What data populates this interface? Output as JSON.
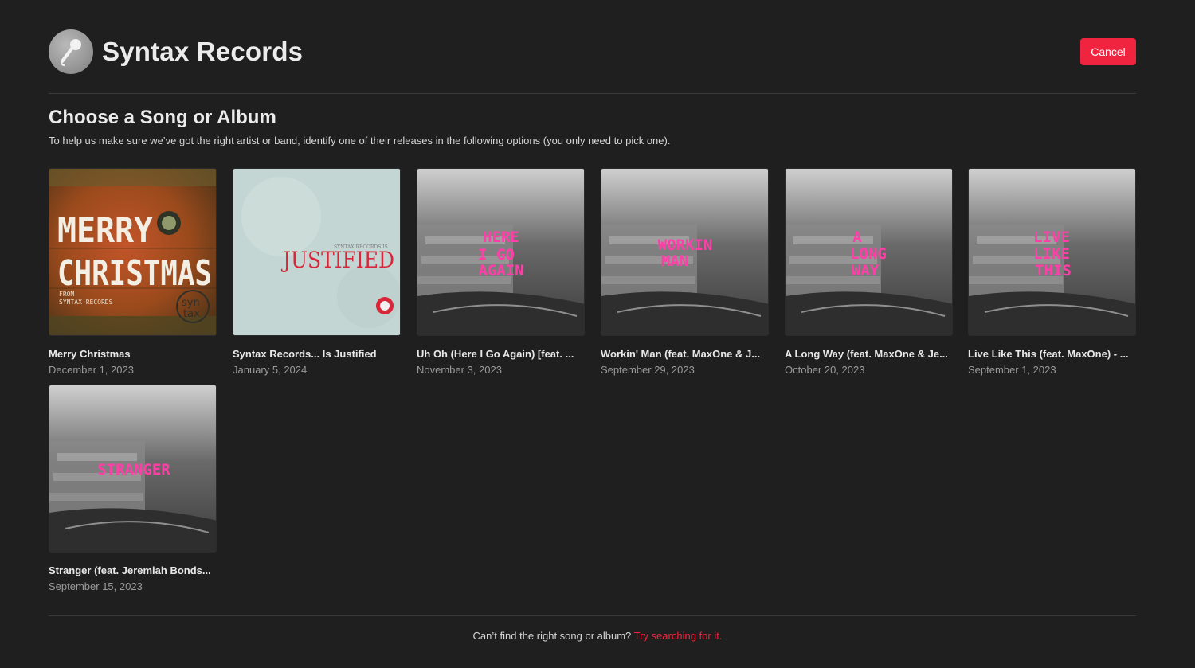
{
  "header": {
    "artist_name": "Syntax Records",
    "cancel_label": "Cancel",
    "avatar_icon": "microphone-icon"
  },
  "section": {
    "title": "Choose a Song or Album",
    "subtitle": "To help us make sure we’ve got the right artist or band, identify one of their releases in the following options (you only need to pick one)."
  },
  "releases": [
    {
      "title": "Merry Christmas",
      "date": "December 1, 2023",
      "art_text": [
        "MERRY",
        "CHRISTMAS"
      ],
      "art_small": [
        "FROM",
        "SYNTAX RECORDS"
      ],
      "art_logo": [
        "syn",
        "tax"
      ]
    },
    {
      "title": "Syntax Records... Is Justified",
      "date": "January 5, 2024",
      "art_text": [
        "JUSTIFIED"
      ],
      "art_small": [
        "SYNTAX RECORDS IS"
      ]
    },
    {
      "title": "Uh Oh (Here I Go Again) [feat. ...",
      "date": "November 3, 2023",
      "art_text": [
        "HERE",
        "I GO",
        "AGAIN"
      ]
    },
    {
      "title": "Workin' Man (feat. MaxOne & J...",
      "date": "September 29, 2023",
      "art_text": [
        "WORKIN",
        "MAN"
      ]
    },
    {
      "title": "A Long Way (feat. MaxOne & Je...",
      "date": "October 20, 2023",
      "art_text": [
        "A",
        "LONG",
        "WAY"
      ]
    },
    {
      "title": "Live Like This (feat. MaxOne) - ...",
      "date": "September 1, 2023",
      "art_text": [
        "LIVE",
        "LIKE",
        "THIS"
      ]
    },
    {
      "title": "Stranger (feat. Jeremiah Bonds...",
      "date": "September 15, 2023",
      "art_text": [
        "STRANGER"
      ]
    }
  ],
  "footer": {
    "text": "Can’t find the right song or album?",
    "link": "Try searching for it."
  },
  "colors": {
    "background": "#1f1f1f",
    "accent": "#f0243f",
    "art_text_pink": "#ff3fa8"
  }
}
